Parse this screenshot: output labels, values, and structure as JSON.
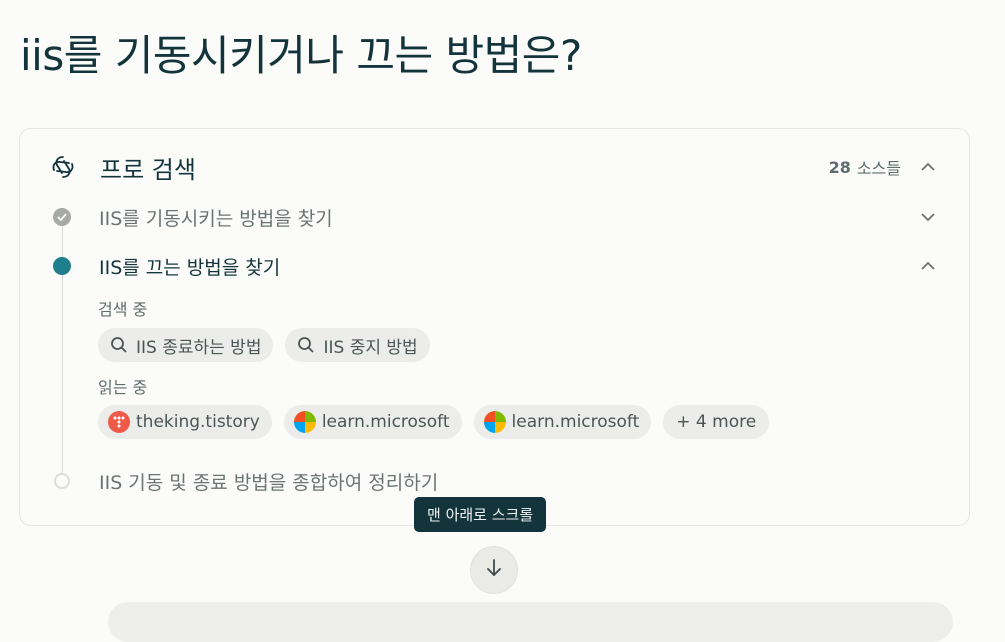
{
  "title": "iis를 기동시키거나 끄는 방법은?",
  "panel": {
    "title": "프로 검색",
    "sources_count": "28",
    "sources_label": "소스들"
  },
  "steps": [
    {
      "label": "IIS를 기동시키는 방법을 찾기",
      "status": "done"
    },
    {
      "label": "IIS를 끄는 방법을 찾기",
      "status": "active"
    },
    {
      "label": "IIS 기동 및 종료 방법을 종합하여 정리하기",
      "status": "pending"
    }
  ],
  "searching": {
    "label": "검색 중",
    "queries": [
      "IIS 종료하는 방법",
      "IIS 중지 방법"
    ]
  },
  "reading": {
    "label": "읽는 중",
    "sources": [
      "theking.tistory",
      "learn.microsoft",
      "learn.microsoft"
    ],
    "more": "+ 4 more"
  },
  "tooltip": "맨 아래로 스크롤",
  "colors": {
    "accent": "#1f7f8c",
    "title": "#13343b",
    "tooltip_bg": "#13343b"
  }
}
